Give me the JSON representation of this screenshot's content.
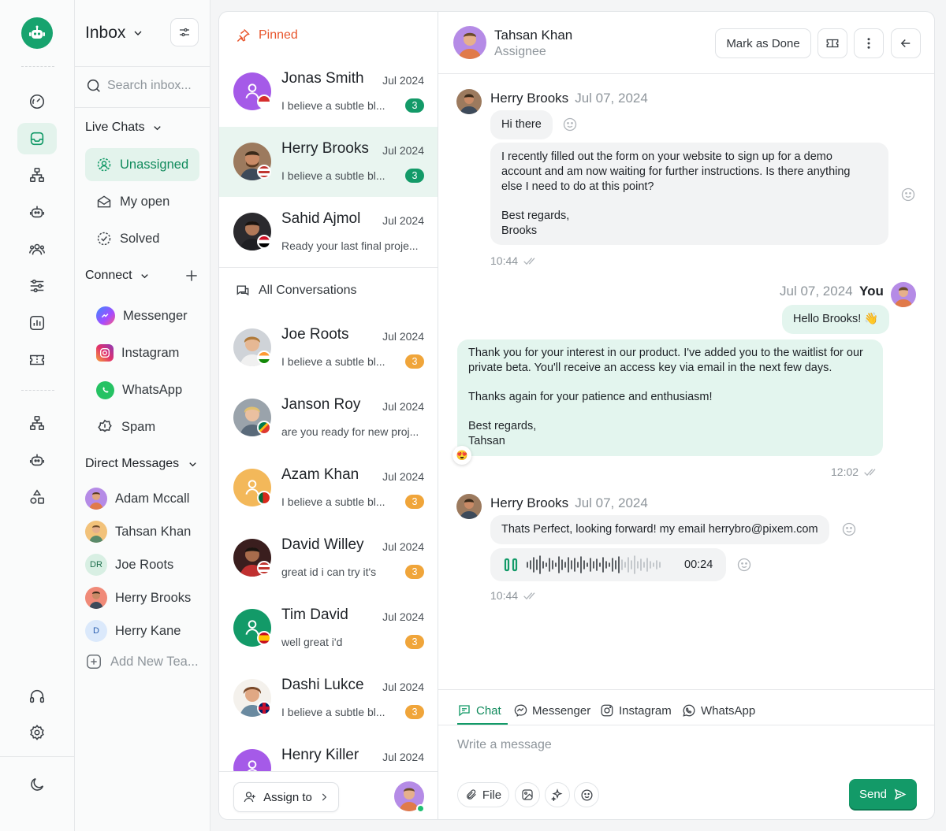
{
  "nav": {
    "title": "Inbox",
    "search_placeholder": "Search inbox...",
    "live_chats": "Live Chats",
    "items": [
      {
        "label": "Unassigned"
      },
      {
        "label": "My open"
      },
      {
        "label": "Solved"
      }
    ],
    "connect": "Connect",
    "channels": [
      {
        "label": "Messenger"
      },
      {
        "label": "Instagram"
      },
      {
        "label": "WhatsApp"
      },
      {
        "label": "Spam"
      }
    ],
    "direct_messages": "Direct Messages",
    "dms": [
      {
        "name": "Adam Mccall"
      },
      {
        "name": "Tahsan Khan"
      },
      {
        "name": "Joe Roots",
        "initials": "DR"
      },
      {
        "name": "Herry Brooks"
      },
      {
        "name": "Herry Kane",
        "initials": "D"
      }
    ],
    "add_team": "Add New Tea..."
  },
  "list": {
    "pinned_label": "Pinned",
    "all_label": "All Conversations",
    "pinned": [
      {
        "name": "Jonas Smith",
        "date": "Jul 2024",
        "message": "I believe a subtle bl...",
        "badge": "3"
      },
      {
        "name": "Herry Brooks",
        "date": "Jul 2024",
        "message": "I believe a subtle bl...",
        "badge": "3"
      },
      {
        "name": "Sahid Ajmol",
        "date": "Jul 2024",
        "message": "Ready your last final proje..."
      }
    ],
    "all": [
      {
        "name": "Joe Roots",
        "date": "Jul 2024",
        "message": "I believe a subtle bl...",
        "badge": "3"
      },
      {
        "name": "Janson Roy",
        "date": "Jul 2024",
        "message": "are you ready for new proj..."
      },
      {
        "name": "Azam Khan",
        "date": "Jul 2024",
        "message": "I believe a subtle bl...",
        "badge": "3"
      },
      {
        "name": "David Willey",
        "date": "Jul 2024",
        "message": "great id i can try it's",
        "badge": "3"
      },
      {
        "name": "Tim David",
        "date": "Jul 2024",
        "message": "well great i'd",
        "badge": "3"
      },
      {
        "name": "Dashi Lukce",
        "date": "Jul 2024",
        "message": "I believe a subtle bl...",
        "badge": "3"
      },
      {
        "name": "Henry Killer",
        "date": "Jul 2024"
      }
    ],
    "assign_label": "Assign to"
  },
  "chat": {
    "header": {
      "name": "Tahsan Khan",
      "role": "Assignee",
      "mark_done": "Mark as Done"
    },
    "msg1": {
      "sender": "Herry Brooks",
      "date": "Jul 07, 2024",
      "hi": "Hi there",
      "body": [
        "I recently filled out the form on your website to sign up for a demo",
        "account and am now waiting for further instructions. Is there anything",
        "else I need to do at this point?",
        "",
        "Best regards,",
        "Brooks"
      ],
      "time": "10:44"
    },
    "msg2": {
      "date": "Jul 07, 2024",
      "sender": "You",
      "hello": "Hello Brooks! 👋",
      "body": [
        "Thank you for your interest in our product. I've added you to the waitlist for our",
        "private beta. You'll receive an access key via email in the next few days.",
        "",
        "Thanks again for your patience and enthusiasm!",
        "",
        "Best regards,",
        "Tahsan"
      ],
      "reaction": "😍",
      "time": "12:02"
    },
    "msg3": {
      "sender": "Herry Brooks",
      "date": "Jul 07, 2024",
      "text": "Thats Perfect, looking forward! my email herrybro@pixem.com",
      "voice_duration": "00:24",
      "time": "10:44"
    },
    "tabs": [
      {
        "label": "Chat"
      },
      {
        "label": "Messenger"
      },
      {
        "label": "Instagram"
      },
      {
        "label": "WhatsApp"
      }
    ],
    "input_placeholder": "Write a message",
    "file_label": "File",
    "send_label": "Send"
  },
  "colors": {
    "accent": "#139a68",
    "accent_light": "#e3f3ec",
    "badge_orange": "#f0a53a",
    "pinned": "#e8562d"
  }
}
